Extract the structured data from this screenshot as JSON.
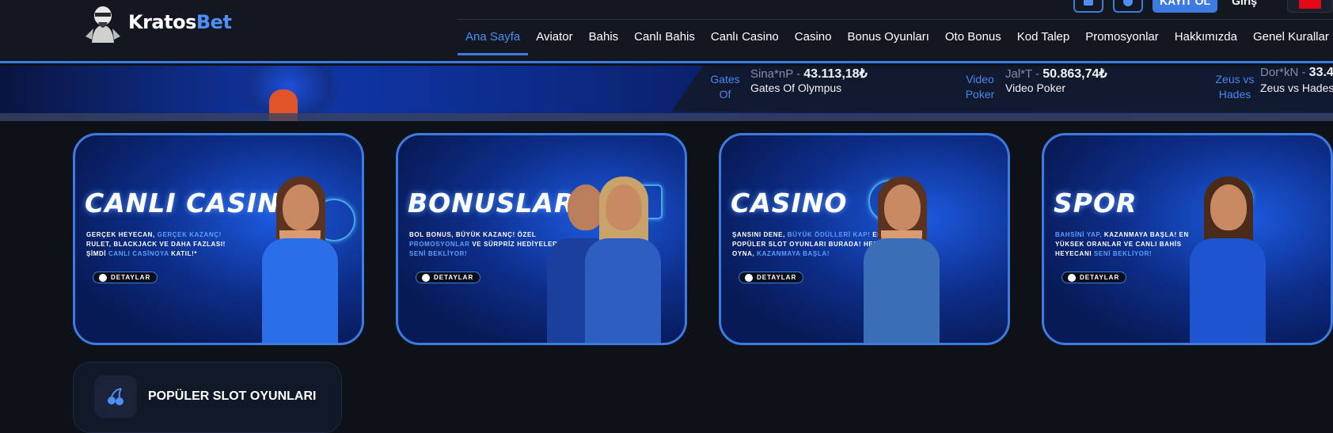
{
  "brand": {
    "name_part1": "Kratos",
    "name_part2": "Bet"
  },
  "header": {
    "register_label": "KAYIT OL",
    "login_label": "Giriş",
    "android_icon": "android-icon",
    "apple_icon": "apple-icon",
    "language_flag": "turkey-flag",
    "nav": [
      {
        "label": "Ana Sayfa",
        "active": true
      },
      {
        "label": "Aviator"
      },
      {
        "label": "Bahis"
      },
      {
        "label": "Canlı Bahis"
      },
      {
        "label": "Canlı Casino"
      },
      {
        "label": "Casino"
      },
      {
        "label": "Bonus Oyunları"
      },
      {
        "label": "Oto Bonus"
      },
      {
        "label": "Kod Talep"
      },
      {
        "label": "Promosyonlar"
      },
      {
        "label": "Hakkımızda"
      },
      {
        "label": "Genel Kurallar"
      }
    ]
  },
  "ticker": [
    {
      "img_alt": "Gates Of",
      "user": "Sina*nP - ",
      "amount": "43.113,18₺",
      "game": "Gates Of Olympus"
    },
    {
      "img_alt": "Video Poker",
      "user": "Jal*T - ",
      "amount": "50.863,74₺",
      "game": "Video Poker"
    },
    {
      "img_alt": "Zeus vs Hades",
      "user": "Dor*kN - ",
      "amount": "33.4",
      "game": "Zeus vs Hades"
    }
  ],
  "cards": [
    {
      "title": "CANLI CASINO",
      "desc": [
        "GERÇEK HEYECAN, ",
        "GERÇEK KAZANÇ!",
        " RULET, BLACKJACK VE DAHA FAZLASI! ŞİMDİ ",
        "CANLI CASİNOYA",
        " KATIL!*"
      ],
      "button": "DETAYLAR"
    },
    {
      "title": "BONUSLAR",
      "desc": [
        "BOL BONUS, BÜYÜK KAZANÇ! ÖZEL ",
        "PROMOSYONLAR",
        " VE SÜRPRİZ HEDİYELER ",
        "SENİ BEKLİYOR!",
        ""
      ],
      "button": "DETAYLAR"
    },
    {
      "title": "CASINO",
      "desc": [
        "ŞANSINI DENE, ",
        "BÜYÜK ÖDÜLLERİ KAP!",
        " EN POPÜLER SLOT OYUNLARI BURADA! HEMEN OYNA, ",
        "KAZANMAYA BAŞLA!",
        ""
      ],
      "button": "DETAYLAR"
    },
    {
      "title": "SPOR",
      "desc": [
        "BAHSİNİ YAP, ",
        "KAZANMAYA BAŞLA!",
        " EN YÜKSEK ORANLAR VE CANLI BAHİS HEYECANI ",
        "SENİ BEKLİYOR!",
        ""
      ],
      "button": "DETAYLAR"
    }
  ],
  "popular": {
    "title": "POPÜLER SLOT OYUNLARI",
    "icon": "cherry-icon"
  },
  "colors": {
    "accent": "#3d7be0",
    "background": "#0e1117",
    "header": "#131720"
  }
}
